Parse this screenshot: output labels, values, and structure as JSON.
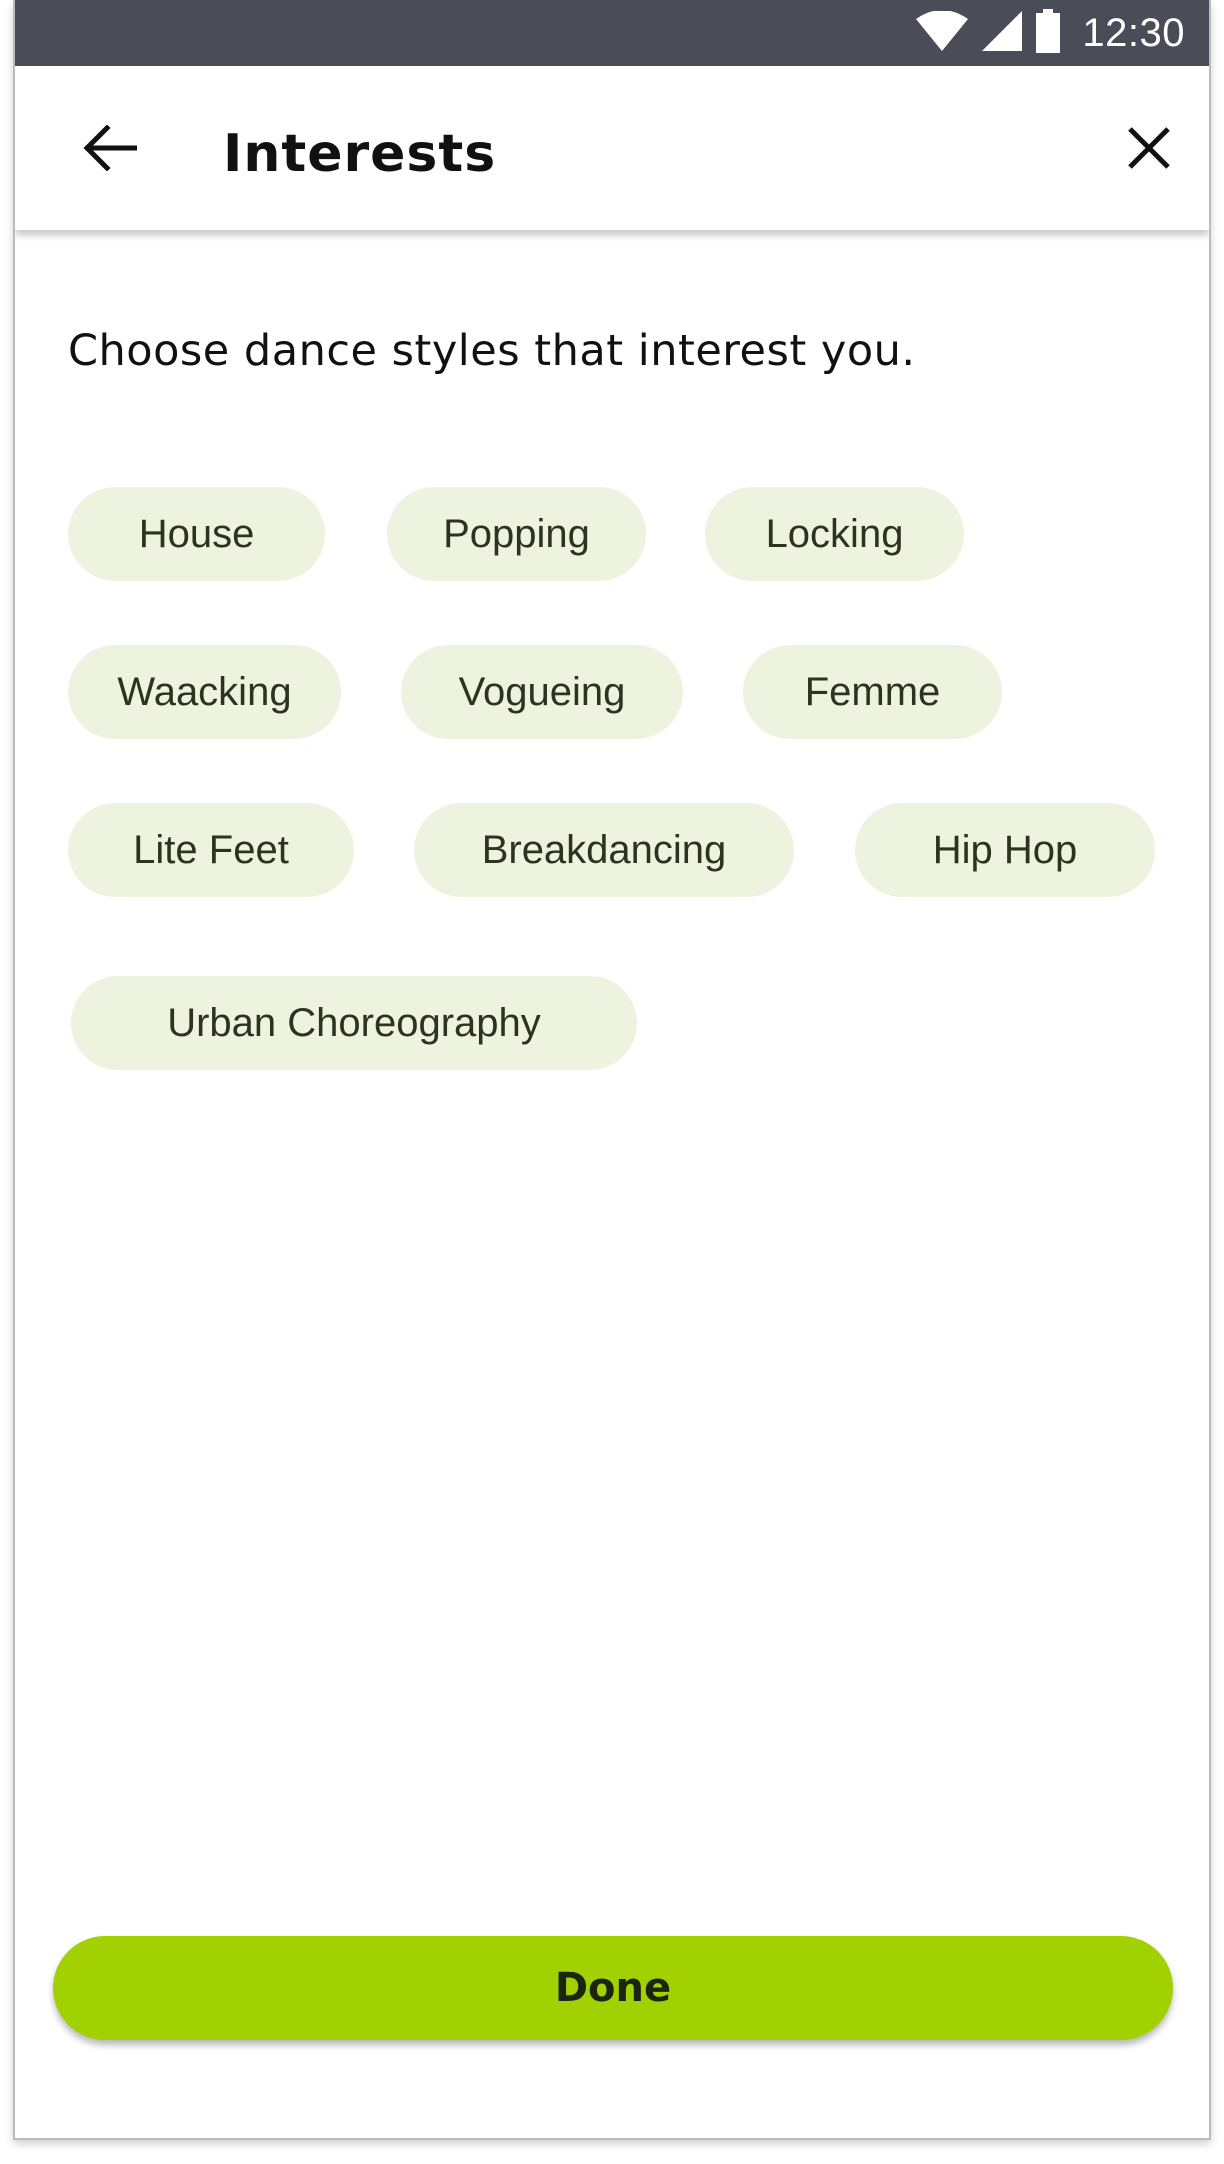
{
  "status_bar": {
    "time": "12:30",
    "icons": [
      "wifi-icon",
      "cell-signal-icon",
      "battery-icon"
    ]
  },
  "app_bar": {
    "title": "Interests",
    "back_icon": "arrow-back-icon",
    "close_icon": "close-icon"
  },
  "main": {
    "prompt": "Choose dance styles that interest you.",
    "chips": [
      {
        "label": "House"
      },
      {
        "label": "Popping"
      },
      {
        "label": "Locking"
      },
      {
        "label": "Waacking"
      },
      {
        "label": "Vogueing"
      },
      {
        "label": "Femme"
      },
      {
        "label": "Lite Feet"
      },
      {
        "label": "Breakdancing"
      },
      {
        "label": "Hip Hop"
      },
      {
        "label": "Urban Choreography"
      }
    ]
  },
  "footer": {
    "done_label": "Done"
  },
  "colors": {
    "status_bar": "#4a4c57",
    "chip_bg": "#eef3df",
    "chip_text": "#2c3421",
    "accent": "#a1d100"
  }
}
